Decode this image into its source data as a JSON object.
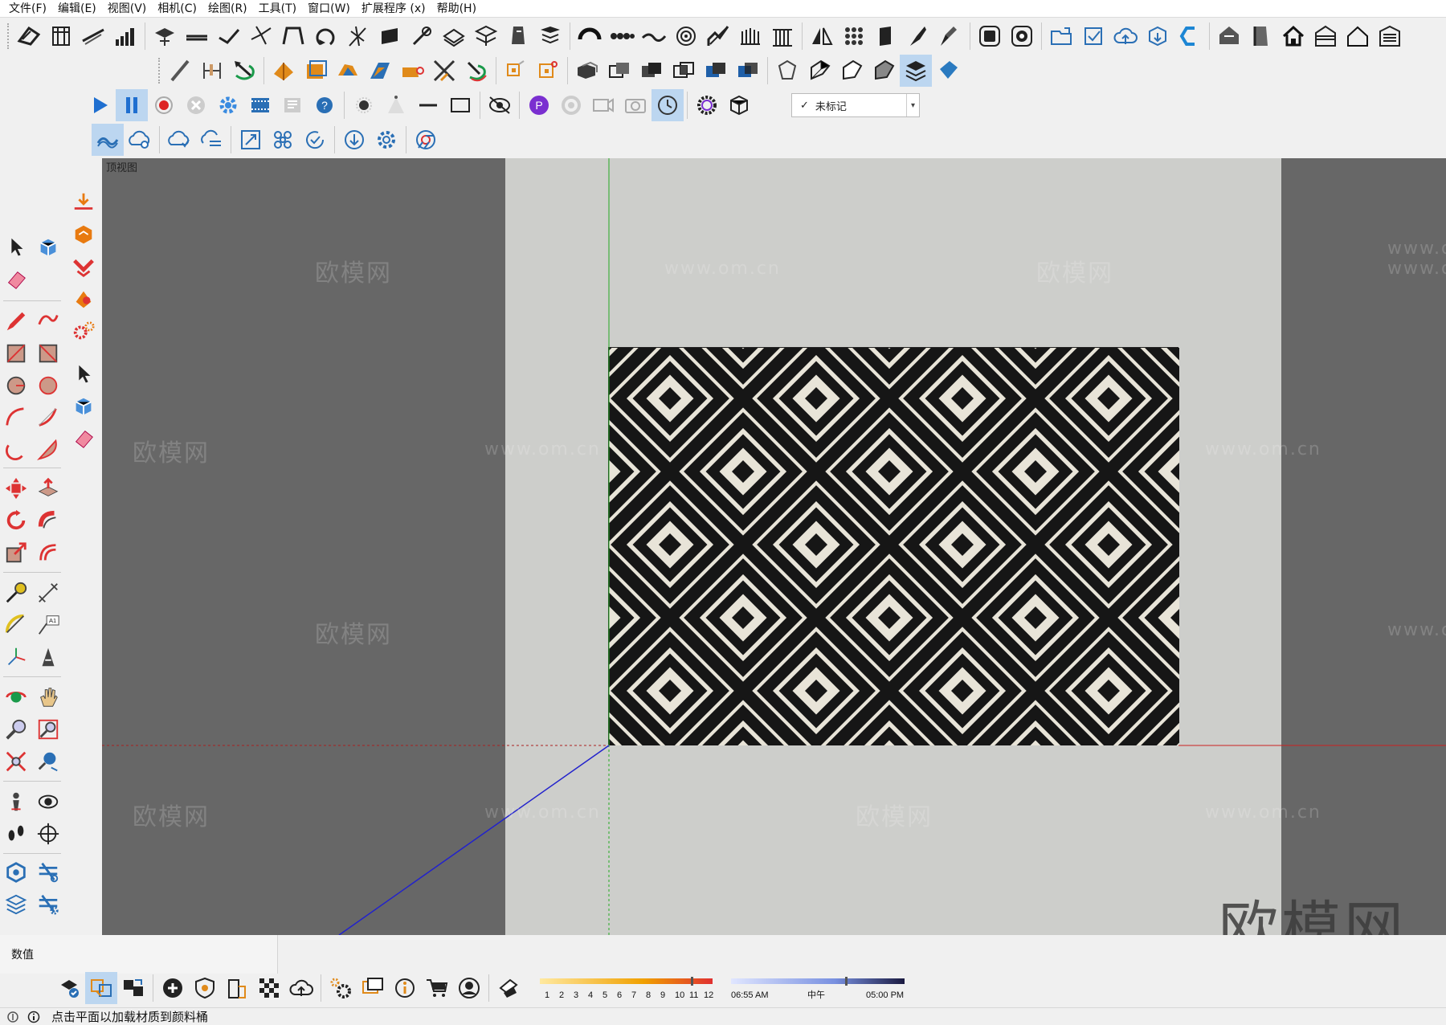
{
  "menu": {
    "items": [
      "文件(F)",
      "编辑(E)",
      "视图(V)",
      "相机(C)",
      "绘图(R)",
      "工具(T)",
      "窗口(W)",
      "扩展程序 (x)",
      "帮助(H)"
    ]
  },
  "tag_select": {
    "value": "未标记",
    "check": "✓"
  },
  "viewport": {
    "scene_label": "顶视图"
  },
  "watermarks": {
    "brand": "欧模网",
    "url": "www.om.cn",
    "brand_large": "欧模网"
  },
  "measurements": {
    "label": "数值"
  },
  "shadow": {
    "months": [
      "1",
      "2",
      "3",
      "4",
      "5",
      "6",
      "7",
      "8",
      "9",
      "10",
      "11",
      "12"
    ],
    "time_start": "06:55 AM",
    "time_mid": "中午",
    "time_end": "05:00 PM"
  },
  "statusbar": {
    "message": "点击平面以加载材质到颜料桶"
  },
  "colors": {
    "viewport_dark": "#676767",
    "viewport_light": "#cdcecb",
    "axis_green": "#22aa22",
    "axis_red": "#cc2222",
    "axis_blue": "#2222cc",
    "toolbar_active": "#bcd6f0"
  },
  "icons": {
    "toolbar1": [
      "sandbox-from-contours-icon",
      "sandbox-from-scratch-icon",
      "smoove-icon",
      "stamp-icon",
      "drape-icon",
      "add-detail-icon",
      "flip-edge-icon",
      "follow-me-icon",
      "offset-icon",
      "intersect-icon",
      "section-plane-icon",
      "section-cuts-icon",
      "section-fill-icon",
      "dimension-icon",
      "protractor-icon",
      "tape-icon",
      "text-icon",
      "axes-icon",
      "3d-text-icon",
      "arc-icon",
      "chain-icon",
      "wave-icon",
      "spiral-icon",
      "stairs-icon",
      "balusters-icon",
      "column-icon",
      "mirror-icon",
      "array-icon",
      "doors-icon",
      "knife-icon",
      "brush-icon",
      "instructor-icon",
      "camera-icon",
      "folder-icon",
      "check-icon",
      "cloud-upload-icon",
      "3d-warehouse-icon",
      "extension-warehouse-icon",
      "house-roof-icon",
      "book-icon",
      "home-icon",
      "shed-icon",
      "house-icon",
      "garage-icon"
    ],
    "toolbar3": [
      "play-icon",
      "pause-icon",
      "record-icon",
      "stop-icon",
      "settings-icon",
      "film-icon",
      "export-icon",
      "help-icon",
      "point-icon",
      "cone-icon",
      "line-icon",
      "rect-icon",
      "hide-icon",
      "profile-icon",
      "orbit-icon",
      "video-icon",
      "screenshot-icon",
      "clock-icon",
      "gear-circle-icon",
      "box-icon"
    ]
  }
}
